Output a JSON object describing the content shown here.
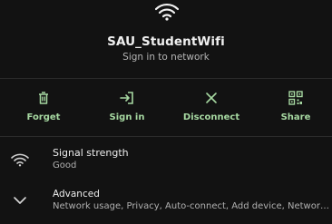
{
  "network": {
    "name": "SAU_StudentWifi",
    "subtitle": "Sign in to network"
  },
  "actions": [
    {
      "label": "Forget",
      "icon": "trash-icon"
    },
    {
      "label": "Sign in",
      "icon": "sign-in-icon"
    },
    {
      "label": "Disconnect",
      "icon": "close-icon"
    },
    {
      "label": "Share",
      "icon": "qr-code-icon"
    }
  ],
  "signal": {
    "title": "Signal strength",
    "value": "Good",
    "icon": "wifi-icon"
  },
  "advanced": {
    "title": "Advanced",
    "summary": "Network usage, Privacy, Auto-connect, Add device, Network details, I…",
    "icon": "chevron-down-icon"
  },
  "colors": {
    "background": "#121212",
    "accent": "#a6d8a1",
    "divider": "#2b2b2b"
  }
}
